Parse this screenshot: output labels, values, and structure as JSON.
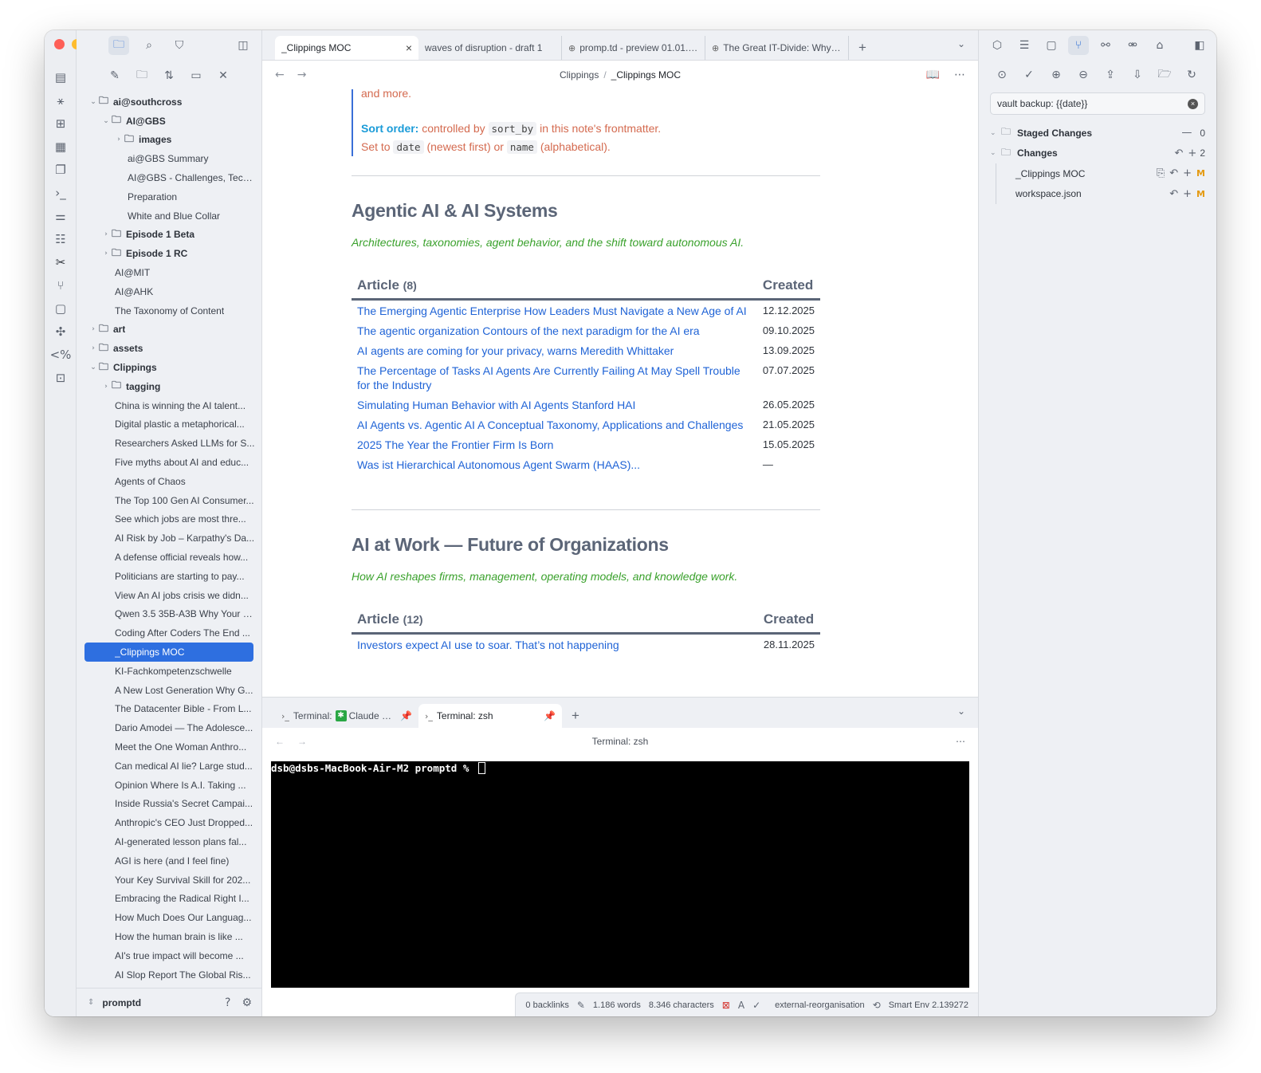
{
  "colors": {
    "accent": "#2e6fe0",
    "link": "#1f63d6",
    "callout_text": "#d46a4f",
    "callout_strong": "#1a9bd8",
    "description": "#3aa12c",
    "modified": "#e49a12"
  },
  "ribbon": {
    "icons": [
      "page-icon",
      "graph-icon",
      "grid-icon",
      "calendar-icon",
      "copy-icon",
      "terminal-icon",
      "sliders-icon",
      "list-icon",
      "tools-icon",
      "git-icon",
      "chat-icon",
      "network-icon",
      "template-icon",
      "code-icon"
    ]
  },
  "sidebar": {
    "vault_name": "promptd",
    "tree": [
      {
        "label": "ai@southcross",
        "type": "folder",
        "depth": 0,
        "open": true
      },
      {
        "label": "AI@GBS",
        "type": "folder",
        "depth": 1,
        "open": true
      },
      {
        "label": "images",
        "type": "folder",
        "depth": 2,
        "open": false
      },
      {
        "label": "ai@GBS Summary",
        "type": "file",
        "depth": 2
      },
      {
        "label": "AI@GBS - Challenges, Tech...",
        "type": "file",
        "depth": 2
      },
      {
        "label": "Preparation",
        "type": "file",
        "depth": 2
      },
      {
        "label": "White and Blue Collar",
        "type": "file",
        "depth": 2
      },
      {
        "label": "Episode 1 Beta",
        "type": "folder",
        "depth": 1,
        "open": false
      },
      {
        "label": "Episode 1 RC",
        "type": "folder",
        "depth": 1,
        "open": false
      },
      {
        "label": "AI@MIT",
        "type": "file",
        "depth": 1
      },
      {
        "label": "AI@AHK",
        "type": "file",
        "depth": 1
      },
      {
        "label": "The Taxonomy of Content",
        "type": "file",
        "depth": 1
      },
      {
        "label": "art",
        "type": "folder",
        "depth": 0,
        "open": false
      },
      {
        "label": "assets",
        "type": "folder",
        "depth": 0,
        "open": false
      },
      {
        "label": "Clippings",
        "type": "folder",
        "depth": 0,
        "open": true
      },
      {
        "label": "tagging",
        "type": "folder",
        "depth": 1,
        "open": false
      },
      {
        "label": "China is winning the AI talent...",
        "type": "file",
        "depth": 1
      },
      {
        "label": "Digital plastic a metaphorical...",
        "type": "file",
        "depth": 1
      },
      {
        "label": "Researchers Asked LLMs for S...",
        "type": "file",
        "depth": 1
      },
      {
        "label": "Five myths about AI and educ...",
        "type": "file",
        "depth": 1
      },
      {
        "label": "Agents of Chaos",
        "type": "file",
        "depth": 1
      },
      {
        "label": "The Top 100 Gen AI Consumer...",
        "type": "file",
        "depth": 1
      },
      {
        "label": "See which jobs are most thre...",
        "type": "file",
        "depth": 1
      },
      {
        "label": "AI Risk by Job – Karpathy's Da...",
        "type": "file",
        "depth": 1
      },
      {
        "label": "A defense official reveals how...",
        "type": "file",
        "depth": 1
      },
      {
        "label": "Politicians are starting to pay...",
        "type": "file",
        "depth": 1
      },
      {
        "label": "View An AI jobs crisis we didn...",
        "type": "file",
        "depth": 1
      },
      {
        "label": "Qwen 3.5 35B-A3B Why Your $...",
        "type": "file",
        "depth": 1
      },
      {
        "label": "Coding After Coders The End ...",
        "type": "file",
        "depth": 1
      },
      {
        "label": "_Clippings MOC",
        "type": "file",
        "depth": 1,
        "selected": true
      },
      {
        "label": "KI-Fachkompetenzschwelle",
        "type": "file",
        "depth": 1
      },
      {
        "label": "A New Lost Generation Why G...",
        "type": "file",
        "depth": 1
      },
      {
        "label": "The Datacenter Bible - From L...",
        "type": "file",
        "depth": 1
      },
      {
        "label": "Dario Amodei — The Adolesce...",
        "type": "file",
        "depth": 1
      },
      {
        "label": "Meet the One Woman Anthro...",
        "type": "file",
        "depth": 1
      },
      {
        "label": "Can medical AI lie? Large stud...",
        "type": "file",
        "depth": 1
      },
      {
        "label": "Opinion Where Is A.I. Taking ...",
        "type": "file",
        "depth": 1
      },
      {
        "label": "Inside Russia's Secret Campai...",
        "type": "file",
        "depth": 1
      },
      {
        "label": "Anthropic's CEO Just Dropped...",
        "type": "file",
        "depth": 1
      },
      {
        "label": "AI-generated lesson plans fal...",
        "type": "file",
        "depth": 1
      },
      {
        "label": "AGI is here (and I feel fine)",
        "type": "file",
        "depth": 1
      },
      {
        "label": "Your Key Survival Skill for 202...",
        "type": "file",
        "depth": 1
      },
      {
        "label": "Embracing the Radical Right I...",
        "type": "file",
        "depth": 1
      },
      {
        "label": "How Much Does Our Languag...",
        "type": "file",
        "depth": 1
      },
      {
        "label": "How the human brain is like ...",
        "type": "file",
        "depth": 1
      },
      {
        "label": "AI's true impact will become ...",
        "type": "file",
        "depth": 1
      },
      {
        "label": "AI Slop Report The Global Ris...",
        "type": "file",
        "depth": 1
      }
    ]
  },
  "tabs": [
    {
      "label": "_Clippings MOC",
      "active": true
    },
    {
      "label": "waves of disruption - draft 1",
      "active": false
    },
    {
      "label": "promp.td - preview 01.01.2...",
      "active": false,
      "icon": "globe-icon"
    },
    {
      "label": "The Great IT-Divide: Why A...",
      "active": false,
      "icon": "globe-icon"
    }
  ],
  "breadcrumb": {
    "folder": "Clippings",
    "separator": "/",
    "note": "_Clippings MOC"
  },
  "doc": {
    "callout": {
      "line0": "and more.",
      "sort_label": "Sort order:",
      "sort_text1": "controlled by",
      "sort_code": "sort_by",
      "sort_text2": "in this note's frontmatter.",
      "set_text1": "Set to",
      "set_code1": "date",
      "set_text2": "(newest first) or",
      "set_code2": "name",
      "set_text3": "(alphabetical)."
    },
    "sections": [
      {
        "title": "Agentic AI & AI Systems",
        "desc": "Architectures, taxonomies, agent behavior, and the shift toward autonomous AI.",
        "col_article": "Article",
        "count": "(8)",
        "col_created": "Created",
        "rows": [
          {
            "title": "The Emerging Agentic Enterprise How Leaders Must Navigate a New Age of AI",
            "date": "12.12.2025"
          },
          {
            "title": "The agentic organization Contours of the next paradigm for the AI era",
            "date": "09.10.2025"
          },
          {
            "title": "AI agents are coming for your privacy, warns Meredith Whittaker",
            "date": "13.09.2025"
          },
          {
            "title": "The Percentage of Tasks AI Agents Are Currently Failing At May Spell Trouble for the Industry",
            "date": "07.07.2025"
          },
          {
            "title": "Simulating Human Behavior with AI Agents Stanford HAI",
            "date": "26.05.2025"
          },
          {
            "title": "AI Agents vs. Agentic AI A Conceptual Taxonomy, Applications and Challenges",
            "date": "21.05.2025"
          },
          {
            "title": "2025 The Year the Frontier Firm Is Born",
            "date": "15.05.2025"
          },
          {
            "title": "Was ist Hierarchical Autonomous Agent Swarm (HAAS)...",
            "date": "—"
          }
        ]
      },
      {
        "title": "AI at Work — Future of Organizations",
        "desc": "How AI reshapes firms, management, operating models, and knowledge work.",
        "col_article": "Article",
        "count": "(12)",
        "col_created": "Created",
        "rows": [
          {
            "title": "Investors expect AI use to soar. That’s not happening",
            "date": "28.11.2025"
          }
        ]
      }
    ]
  },
  "terminal": {
    "tabs": [
      {
        "label": "Terminal:",
        "extra": "Claude C..."
      },
      {
        "label": "Terminal: zsh"
      }
    ],
    "title": "Terminal: zsh",
    "prompt": "dsb@dsbs-MacBook-Air-M2 promptd % "
  },
  "status": {
    "backlinks": "0 backlinks",
    "words": "1.186 words",
    "chars": "8.346 characters",
    "branch": "external-reorganisation",
    "smart_env": "Smart Env 2.139272"
  },
  "git": {
    "commit_message": "vault backup: {{date}}",
    "staged_label": "Staged Changes",
    "staged_count": "0",
    "changes_label": "Changes",
    "changes_count": "2",
    "files": [
      {
        "name": "_Clippings MOC",
        "status": "M"
      },
      {
        "name": "workspace.json",
        "status": "M"
      }
    ]
  }
}
